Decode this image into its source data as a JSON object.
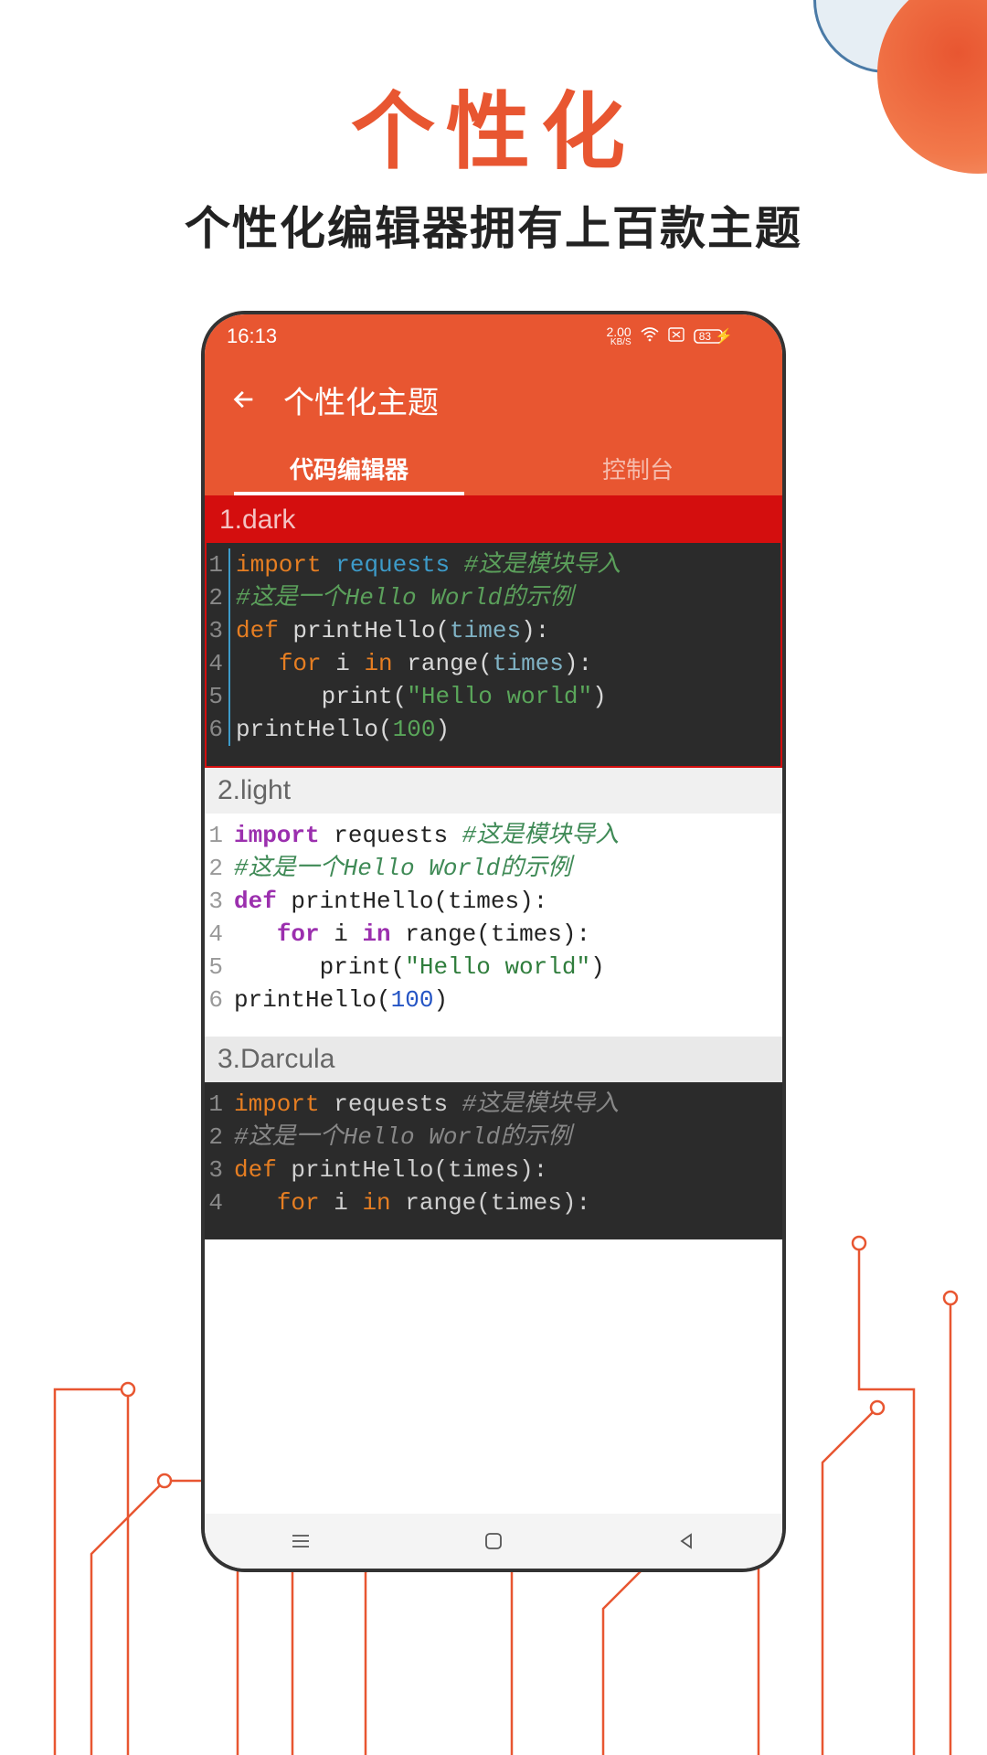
{
  "hero": {
    "title": "个性化",
    "subtitle": "个性化编辑器拥有上百款主题"
  },
  "statusbar": {
    "time": "16:13",
    "net_speed": "2.00",
    "net_unit": "KB/S",
    "battery": "83"
  },
  "appbar": {
    "title": "个性化主题"
  },
  "tabs": [
    {
      "label": "代码编辑器",
      "active": true
    },
    {
      "label": "控制台",
      "active": false
    }
  ],
  "themes": [
    {
      "index": "1",
      "name": "dark",
      "selected": true,
      "style": "dark"
    },
    {
      "index": "2",
      "name": "light",
      "selected": false,
      "style": "light"
    },
    {
      "index": "3",
      "name": "Darcula",
      "selected": false,
      "style": "darcula"
    }
  ],
  "sample_code": {
    "lines": [
      {
        "n": "1",
        "tokens": [
          {
            "t": "import",
            "c": "kw"
          },
          {
            "t": " ",
            "c": ""
          },
          {
            "t": "requests",
            "c": "mod"
          },
          {
            "t": " ",
            "c": ""
          },
          {
            "t": "#这是模块导入",
            "c": "cm"
          }
        ]
      },
      {
        "n": "2",
        "tokens": [
          {
            "t": "#这是一个Hello World的示例",
            "c": "cm"
          }
        ]
      },
      {
        "n": "3",
        "tokens": [
          {
            "t": "def",
            "c": "kw"
          },
          {
            "t": " printHello(",
            "c": "fn"
          },
          {
            "t": "times",
            "c": "arg"
          },
          {
            "t": "):",
            "c": "fn"
          }
        ]
      },
      {
        "n": "4",
        "tokens": [
          {
            "t": "   ",
            "c": ""
          },
          {
            "t": "for",
            "c": "kw"
          },
          {
            "t": " i ",
            "c": "fn"
          },
          {
            "t": "in",
            "c": "kw"
          },
          {
            "t": " range(",
            "c": "fn"
          },
          {
            "t": "times",
            "c": "arg"
          },
          {
            "t": "):",
            "c": "fn"
          }
        ]
      },
      {
        "n": "5",
        "tokens": [
          {
            "t": "      print(",
            "c": "fn"
          },
          {
            "t": "\"Hello world\"",
            "c": "str"
          },
          {
            "t": ")",
            "c": "fn"
          }
        ]
      },
      {
        "n": "6",
        "tokens": [
          {
            "t": "printHello(",
            "c": "fn"
          },
          {
            "t": "100",
            "c": "num"
          },
          {
            "t": ")",
            "c": "fn"
          }
        ]
      }
    ]
  }
}
